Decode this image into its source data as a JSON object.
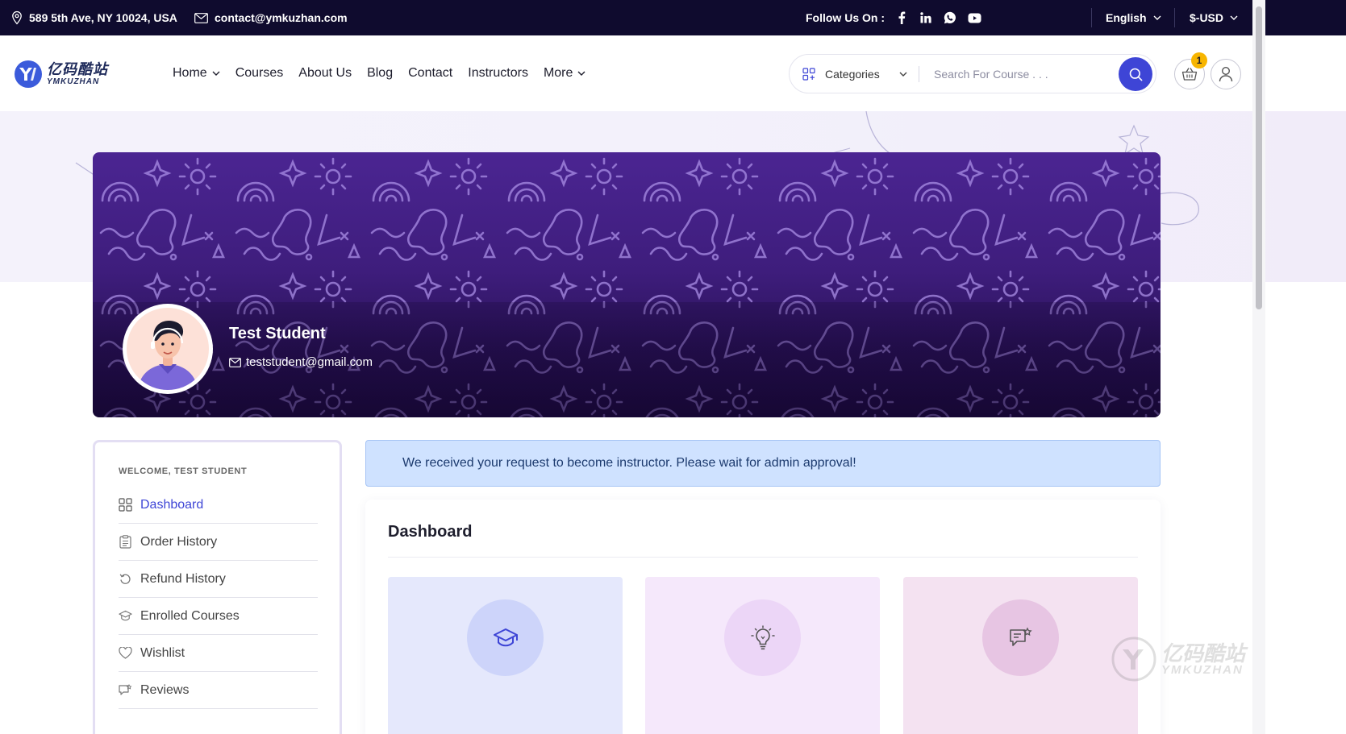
{
  "topbar": {
    "address": "589 5th Ave, NY 10024, USA",
    "email": "contact@ymkuzhan.com",
    "follow_label": "Follow Us On :",
    "social_icons": [
      "facebook-icon",
      "linkedin-icon",
      "whatsapp-icon",
      "youtube-icon"
    ],
    "language": "English",
    "currency": "$-USD"
  },
  "header": {
    "logo_cn": "亿码酷站",
    "logo_en": "YMKUZHAN",
    "nav": [
      {
        "label": "Home",
        "has_dropdown": true
      },
      {
        "label": "Courses",
        "has_dropdown": false
      },
      {
        "label": "About Us",
        "has_dropdown": false
      },
      {
        "label": "Blog",
        "has_dropdown": false
      },
      {
        "label": "Contact",
        "has_dropdown": false
      },
      {
        "label": "Instructors",
        "has_dropdown": false
      },
      {
        "label": "More",
        "has_dropdown": true
      }
    ],
    "categories_label": "Categories",
    "search_placeholder": "Search For Course . . .",
    "cart_count": "1"
  },
  "profile": {
    "name": "Test Student",
    "email": "teststudent@gmail.com"
  },
  "sidebar": {
    "welcome": "WELCOME, TEST STUDENT",
    "items": [
      {
        "label": "Dashboard",
        "icon": "dashboard-icon",
        "active": true
      },
      {
        "label": "Order History",
        "icon": "clipboard-icon",
        "active": false
      },
      {
        "label": "Refund History",
        "icon": "refund-icon",
        "active": false
      },
      {
        "label": "Enrolled Courses",
        "icon": "graduation-cap-icon",
        "active": false
      },
      {
        "label": "Wishlist",
        "icon": "heart-icon",
        "active": false
      },
      {
        "label": "Reviews",
        "icon": "review-icon",
        "active": false
      }
    ]
  },
  "main": {
    "alert": "We received your request to become instructor. Please wait for admin approval!",
    "panel_title": "Dashboard",
    "cards": [
      {
        "icon": "graduation-cap-icon",
        "bg": "#e5e8fc",
        "circle": "#cdd4fa",
        "color": "#3e45d6"
      },
      {
        "icon": "lightbulb-icon",
        "bg": "#f5e8fb",
        "circle": "#ecd6f7",
        "color": "#555555"
      },
      {
        "icon": "review-icon",
        "bg": "#f4e2f1",
        "circle": "#e7c5e3",
        "color": "#555555"
      }
    ]
  },
  "colors": {
    "topbar_bg": "#0f0b2e",
    "accent": "#3e45d6",
    "badge": "#f7b500"
  }
}
